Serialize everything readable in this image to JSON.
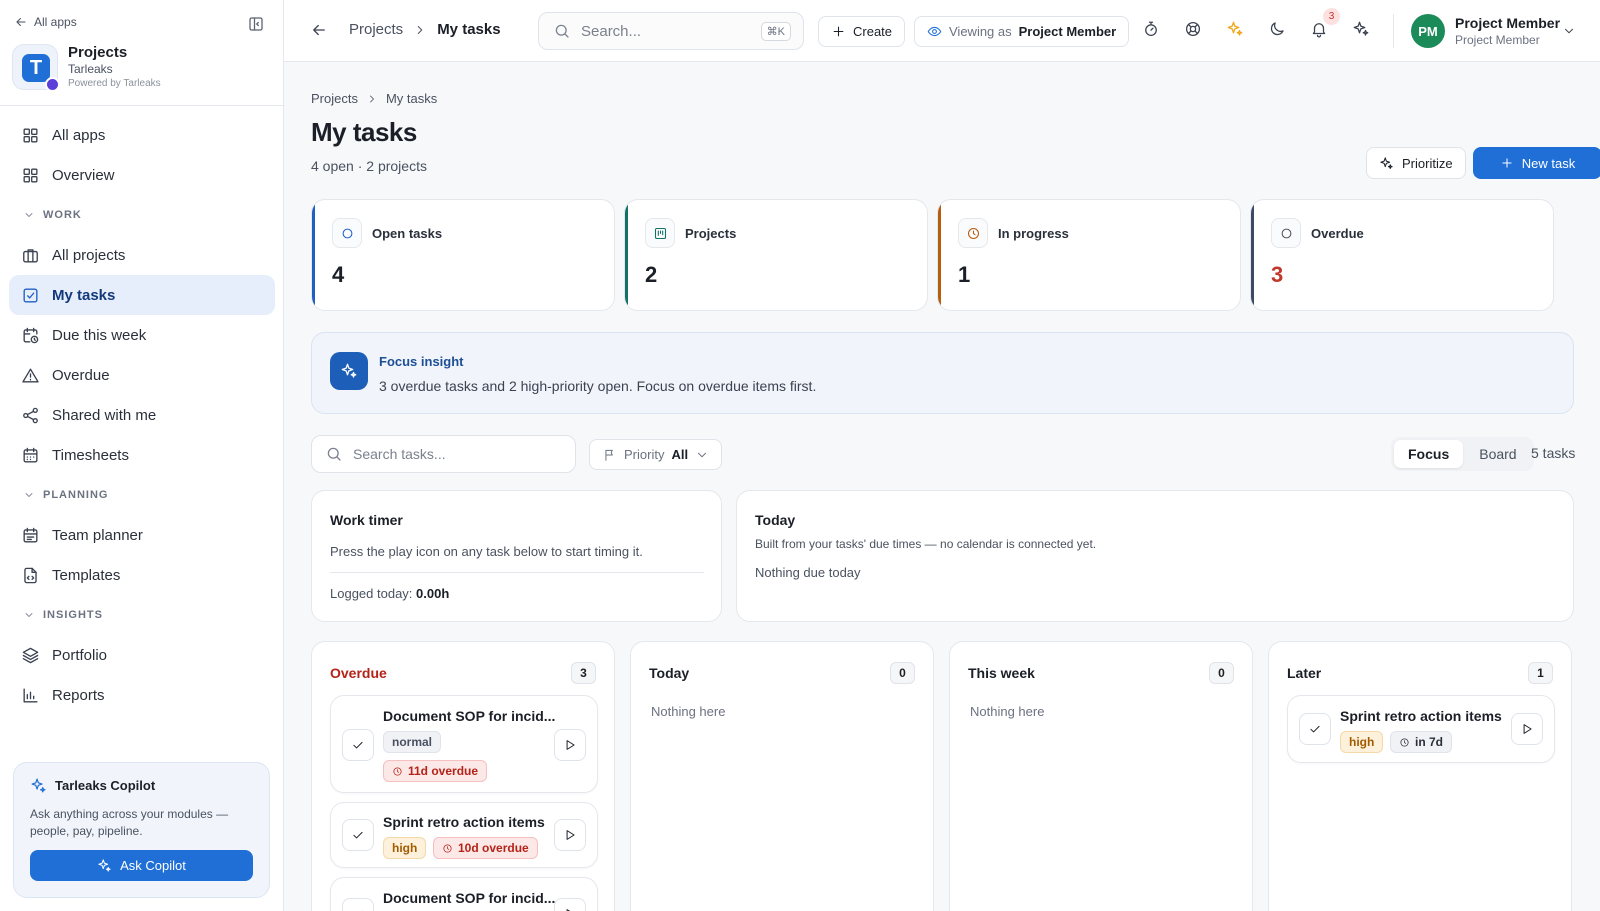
{
  "sidebar": {
    "all_apps_link": "All apps",
    "brand": {
      "title": "Projects",
      "subtitle": "Tarleaks",
      "powered": "Powered by Tarleaks",
      "logo_letter": "T"
    },
    "items_top": [
      {
        "label": "All apps",
        "icon": "grid-icon"
      },
      {
        "label": "Overview",
        "icon": "grid-icon"
      }
    ],
    "sections": {
      "work": "WORK",
      "planning": "PLANNING",
      "insights": "INSIGHTS"
    },
    "work_items": [
      {
        "label": "All projects",
        "icon": "briefcase-icon"
      },
      {
        "label": "My tasks",
        "icon": "checkbox-icon"
      },
      {
        "label": "Due this week",
        "icon": "calendar-clock-icon"
      },
      {
        "label": "Overdue",
        "icon": "warning-icon"
      },
      {
        "label": "Shared with me",
        "icon": "share-icon"
      },
      {
        "label": "Timesheets",
        "icon": "calendar-icon"
      }
    ],
    "planning_items": [
      {
        "label": "Team planner",
        "icon": "calendar-icon"
      },
      {
        "label": "Templates",
        "icon": "template-icon"
      }
    ],
    "insights_items": [
      {
        "label": "Portfolio",
        "icon": "layers-icon"
      },
      {
        "label": "Reports",
        "icon": "bar-chart-icon"
      }
    ],
    "copilot": {
      "title": "Tarleaks Copilot",
      "description": "Ask anything across your modules — people, pay, pipeline.",
      "button": "Ask Copilot"
    }
  },
  "topbar": {
    "breadcrumb_parent": "Projects",
    "breadcrumb_current": "My tasks",
    "search_placeholder": "Search...",
    "search_shortcut": "⌘K",
    "create_label": "Create",
    "viewing_as_prefix": "Viewing as",
    "viewing_as_role": "Project Member",
    "notification_count": "3",
    "user": {
      "initials": "PM",
      "name": "Project Member",
      "role": "Project Member"
    }
  },
  "page": {
    "breadcrumb_parent": "Projects",
    "breadcrumb_current": "My tasks",
    "title": "My tasks",
    "subtitle": "4 open · 2 projects",
    "prioritize_label": "Prioritize",
    "new_task_label": "New task"
  },
  "stats": [
    {
      "label": "Open tasks",
      "value": "4",
      "accent": "#1f5fc4"
    },
    {
      "label": "Projects",
      "value": "2",
      "accent": "#137268"
    },
    {
      "label": "In progress",
      "value": "1",
      "accent": "#b85c0d"
    },
    {
      "label": "Overdue",
      "value": "3",
      "accent": "#3d4a66",
      "value_color": "#c0392b"
    }
  ],
  "insight": {
    "title": "Focus insight",
    "text": "3 overdue tasks and 2 high-priority open. Focus on overdue items first."
  },
  "filters": {
    "search_placeholder": "Search tasks...",
    "priority_label": "Priority",
    "priority_value": "All",
    "views": [
      "Focus",
      "Board"
    ],
    "active_view": "Focus",
    "task_count": "5 tasks"
  },
  "work_timer": {
    "title": "Work timer",
    "description": "Press the play icon on any task below to start timing it.",
    "logged_label": "Logged today:",
    "logged_value": "0.00h"
  },
  "today_panel": {
    "title": "Today",
    "description": "Built from your tasks' due times — no calendar is connected yet.",
    "empty": "Nothing due today"
  },
  "columns": [
    {
      "title": "Overdue",
      "count": "3",
      "title_color": "#b42318",
      "tasks": [
        {
          "title": "Document SOP for incid...",
          "priority": "normal",
          "due": "11d overdue"
        },
        {
          "title": "Sprint retro action items",
          "priority": "high",
          "due": "10d overdue"
        },
        {
          "title": "Document SOP for incid...",
          "priority": "",
          "due": ""
        }
      ]
    },
    {
      "title": "Today",
      "count": "0",
      "empty": "Nothing here"
    },
    {
      "title": "This week",
      "count": "0",
      "empty": "Nothing here"
    },
    {
      "title": "Later",
      "count": "1",
      "tasks": [
        {
          "title": "Sprint retro action items",
          "priority": "high",
          "due": "in 7d"
        }
      ]
    }
  ]
}
